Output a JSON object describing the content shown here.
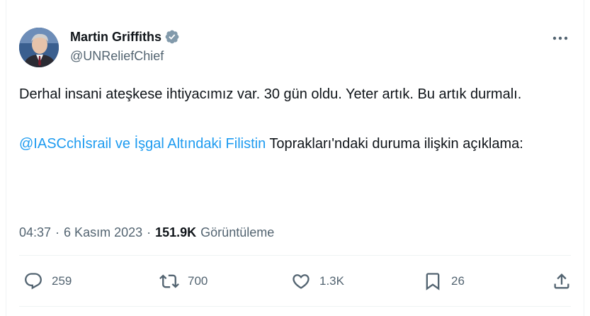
{
  "author": {
    "name": "Martin Griffiths",
    "handle": "@UNReliefChief",
    "verified_color": "#829aab"
  },
  "more_icon": "more-horizontal-icon",
  "tweet": {
    "para1": "Derhal insani ateşkese ihtiyacımız var. 30 gün oldu. Yeter artık. Bu artık durmalı.",
    "mention": "@IASCchİsrail ve İşgal Altındaki Filistin",
    "para2_rest": " Toprakları'ndaki duruma ilişkin açıklama:"
  },
  "meta": {
    "time": "04:37",
    "sep1": "·",
    "date": "6 Kasım 2023",
    "sep2": "·",
    "views": "151.9K",
    "views_label": "Görüntüleme"
  },
  "actions": {
    "replies": "259",
    "retweets": "700",
    "likes": "1.3K",
    "bookmarks": "26"
  },
  "colors": {
    "link": "#1d9bf0",
    "secondary": "#536471",
    "text": "#0f1419"
  }
}
